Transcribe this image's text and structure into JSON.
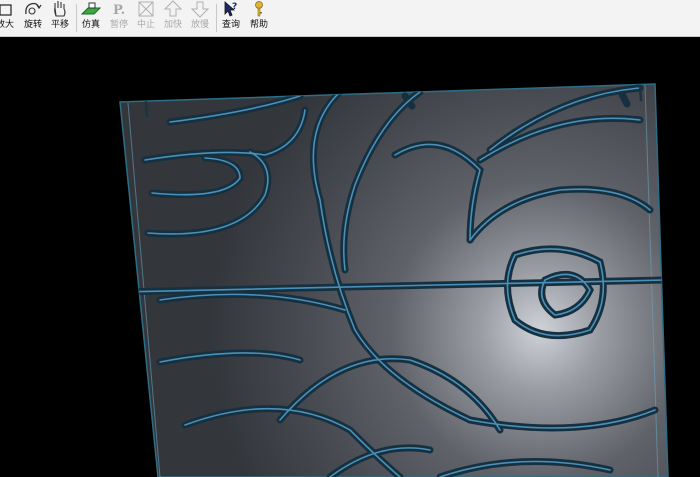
{
  "toolbar": {
    "buttons": [
      {
        "id": "zoom",
        "label": "放大",
        "icon": "zoom-icon",
        "enabled": true
      },
      {
        "id": "rotate",
        "label": "旋转",
        "icon": "rotate-icon",
        "enabled": true
      },
      {
        "id": "pan",
        "label": "平移",
        "icon": "pan-hand-icon",
        "enabled": true
      },
      {
        "id": "simulate",
        "label": "仿真",
        "icon": "simulate-icon",
        "enabled": true
      },
      {
        "id": "pause",
        "label": "暂停",
        "icon": "pause-icon",
        "enabled": false
      },
      {
        "id": "stop",
        "label": "中止",
        "icon": "stop-icon",
        "enabled": false
      },
      {
        "id": "faster",
        "label": "加快",
        "icon": "speed-up-icon",
        "enabled": false
      },
      {
        "id": "slower",
        "label": "放慢",
        "icon": "slow-down-icon",
        "enabled": false
      },
      {
        "id": "query",
        "label": "查询",
        "icon": "query-icon",
        "enabled": true
      },
      {
        "id": "help",
        "label": "帮助",
        "icon": "help-icon",
        "enabled": true
      }
    ]
  },
  "viewport": {
    "background": "#000000",
    "panel_color": "#3a3d42",
    "groove_color": "#4a90b8"
  }
}
